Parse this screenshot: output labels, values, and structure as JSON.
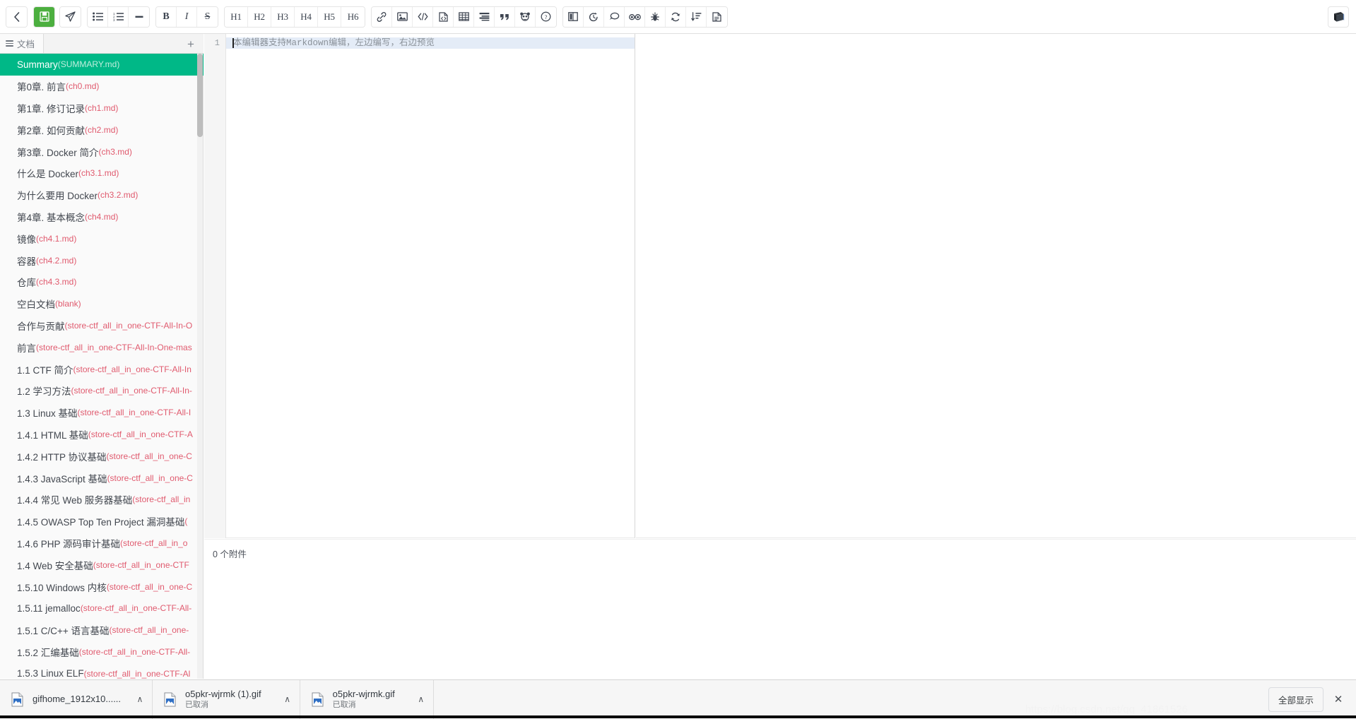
{
  "toolbar": {
    "groups": [
      {
        "name": "nav",
        "buttons": [
          {
            "id": "back",
            "icon": "chevron-left-icon",
            "label": "‹",
            "title": "返回"
          }
        ]
      },
      {
        "name": "file",
        "buttons": [
          {
            "id": "save",
            "icon": "save-disk-icon",
            "label": "",
            "title": "保存"
          }
        ]
      },
      {
        "name": "publish",
        "buttons": [
          {
            "id": "publish",
            "icon": "paper-plane-icon",
            "label": "",
            "title": "发布"
          }
        ]
      },
      {
        "name": "lists",
        "buttons": [
          {
            "id": "ul",
            "icon": "bullet-list-icon",
            "label": "",
            "title": "无序列表"
          },
          {
            "id": "ol",
            "icon": "numbered-list-icon",
            "label": "",
            "title": "有序列表"
          },
          {
            "id": "hr",
            "icon": "horizontal-rule-icon",
            "label": "",
            "title": "分割线"
          }
        ]
      },
      {
        "name": "format",
        "buttons": [
          {
            "id": "bold",
            "icon": "bold-icon",
            "label": "B",
            "title": "粗体"
          },
          {
            "id": "italic",
            "icon": "italic-icon",
            "label": "I",
            "title": "斜体"
          },
          {
            "id": "strike",
            "icon": "strikethrough-icon",
            "label": "S",
            "title": "删除线"
          }
        ]
      },
      {
        "name": "headings",
        "buttons": [
          {
            "id": "h1",
            "icon": "heading-1-icon",
            "label": "H1",
            "title": "标题1"
          },
          {
            "id": "h2",
            "icon": "heading-2-icon",
            "label": "H2",
            "title": "标题2"
          },
          {
            "id": "h3",
            "icon": "heading-3-icon",
            "label": "H3",
            "title": "标题3"
          },
          {
            "id": "h4",
            "icon": "heading-4-icon",
            "label": "H4",
            "title": "标题4"
          },
          {
            "id": "h5",
            "icon": "heading-5-icon",
            "label": "H5",
            "title": "标题5"
          },
          {
            "id": "h6",
            "icon": "heading-6-icon",
            "label": "H6",
            "title": "标题6"
          }
        ]
      },
      {
        "name": "insert",
        "buttons": [
          {
            "id": "link",
            "icon": "link-icon",
            "label": "",
            "title": "链接"
          },
          {
            "id": "image",
            "icon": "image-icon",
            "label": "",
            "title": "图片"
          },
          {
            "id": "inline-code",
            "icon": "code-inline-icon",
            "label": "",
            "title": "行内代码"
          },
          {
            "id": "code-block",
            "icon": "code-block-icon",
            "label": "",
            "title": "代码块"
          },
          {
            "id": "table",
            "icon": "table-icon",
            "label": "",
            "title": "表格"
          },
          {
            "id": "align",
            "icon": "align-icon",
            "label": "",
            "title": "对齐"
          },
          {
            "id": "quote",
            "icon": "quote-icon",
            "label": "",
            "title": "引用"
          },
          {
            "id": "emoji",
            "icon": "panda-emoji-icon",
            "label": "",
            "title": "表情"
          },
          {
            "id": "help",
            "icon": "help-circle-icon",
            "label": "",
            "title": "帮助"
          }
        ]
      },
      {
        "name": "view",
        "buttons": [
          {
            "id": "split-view",
            "icon": "split-pane-icon",
            "label": "",
            "title": "分屏预览"
          },
          {
            "id": "history",
            "icon": "history-revert-icon",
            "label": "",
            "title": "历史"
          },
          {
            "id": "comment",
            "icon": "comment-bubble-icon",
            "label": "",
            "title": "评论"
          },
          {
            "id": "glasses",
            "icon": "glasses-icon",
            "label": "",
            "title": "阅读模式"
          },
          {
            "id": "bug",
            "icon": "bug-icon",
            "label": "",
            "title": "反馈"
          },
          {
            "id": "sync",
            "icon": "sync-refresh-icon",
            "label": "",
            "title": "同步"
          },
          {
            "id": "sort",
            "icon": "sort-descending-icon",
            "label": "",
            "title": "排序"
          },
          {
            "id": "doc",
            "icon": "document-icon",
            "label": "",
            "title": "文档"
          }
        ]
      }
    ],
    "right_button": {
      "id": "book",
      "icon": "book-icon",
      "title": "书籍"
    }
  },
  "sidebar": {
    "tab_label": "文档",
    "add_label": "+",
    "items": [
      {
        "name": "Summary",
        "path": "(SUMMARY.md)",
        "active": true
      },
      {
        "name": "第0章. 前言",
        "path": "(ch0.md)",
        "active": false
      },
      {
        "name": "第1章. 修订记录",
        "path": "(ch1.md)",
        "active": false
      },
      {
        "name": "第2章. 如何贡献",
        "path": "(ch2.md)",
        "active": false
      },
      {
        "name": "第3章. Docker 简介",
        "path": "(ch3.md)",
        "active": false
      },
      {
        "name": "什么是 Docker",
        "path": "(ch3.1.md)",
        "active": false
      },
      {
        "name": "为什么要用 Docker",
        "path": "(ch3.2.md)",
        "active": false
      },
      {
        "name": "第4章. 基本概念",
        "path": "(ch4.md)",
        "active": false
      },
      {
        "name": "镜像",
        "path": "(ch4.1.md)",
        "active": false
      },
      {
        "name": "容器",
        "path": "(ch4.2.md)",
        "active": false
      },
      {
        "name": "仓库",
        "path": "(ch4.3.md)",
        "active": false
      },
      {
        "name": "空白文档",
        "path": "(blank)",
        "active": false
      },
      {
        "name": "合作与贡献",
        "path": "(store-ctf_all_in_one-CTF-All-In-O",
        "active": false
      },
      {
        "name": "前言",
        "path": "(store-ctf_all_in_one-CTF-All-In-One-mas",
        "active": false
      },
      {
        "name": "1.1 CTF 简介",
        "path": "(store-ctf_all_in_one-CTF-All-In",
        "active": false
      },
      {
        "name": "1.2 学习方法",
        "path": "(store-ctf_all_in_one-CTF-All-In-",
        "active": false
      },
      {
        "name": "1.3 Linux 基础",
        "path": "(store-ctf_all_in_one-CTF-All-I",
        "active": false
      },
      {
        "name": "1.4.1 HTML 基础",
        "path": "(store-ctf_all_in_one-CTF-A",
        "active": false
      },
      {
        "name": "1.4.2 HTTP 协议基础",
        "path": "(store-ctf_all_in_one-C",
        "active": false
      },
      {
        "name": "1.4.3 JavaScript 基础",
        "path": "(store-ctf_all_in_one-C",
        "active": false
      },
      {
        "name": "1.4.4 常见 Web 服务器基础",
        "path": "(store-ctf_all_in",
        "active": false
      },
      {
        "name": "1.4.5 OWASP Top Ten Project 漏洞基础",
        "path": "(",
        "active": false
      },
      {
        "name": "1.4.6 PHP 源码审计基础",
        "path": "(store-ctf_all_in_o",
        "active": false
      },
      {
        "name": "1.4 Web 安全基础",
        "path": "(store-ctf_all_in_one-CTF",
        "active": false
      },
      {
        "name": "1.5.10 Windows 内核",
        "path": "(store-ctf_all_in_one-C",
        "active": false
      },
      {
        "name": "1.5.11 jemalloc",
        "path": "(store-ctf_all_in_one-CTF-All-",
        "active": false
      },
      {
        "name": "1.5.1 C/C++ 语言基础",
        "path": "(store-ctf_all_in_one-",
        "active": false
      },
      {
        "name": "1.5.2 汇编基础",
        "path": "(store-ctf_all_in_one-CTF-All-",
        "active": false
      },
      {
        "name": "1.5.3 Linux ELF",
        "path": "(store-ctf_all_in_one-CTF-Al",
        "active": false
      }
    ]
  },
  "editor": {
    "line_numbers": [
      "1"
    ],
    "placeholder": "本编辑器支持Markdown编辑，左边编写，右边预览",
    "value": "",
    "attachments_label": "0 个附件"
  },
  "download_bar": {
    "items": [
      {
        "name": "gifhome_1912x10......",
        "status": "",
        "caret": "∧"
      },
      {
        "name": "o5pkr-wjrmk (1).gif",
        "status": "已取消",
        "caret": "∧"
      },
      {
        "name": "o5pkr-wjrmk.gif",
        "status": "已取消",
        "caret": "∧"
      }
    ],
    "show_all_label": "全部显示",
    "close_label": "✕",
    "watermark": "https://blog.csdn.net/qq_41861526"
  },
  "colors": {
    "accent_green": "#00b887",
    "save_green": "#4caf3f",
    "path_red": "#e05a6e",
    "active_line": "#e4ecf7"
  }
}
